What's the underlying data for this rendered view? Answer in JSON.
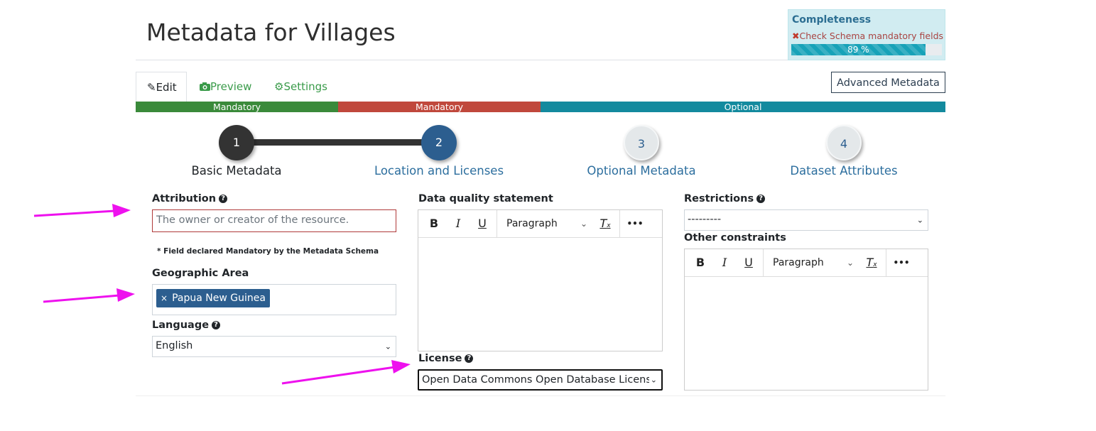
{
  "page": {
    "title": "Metadata for Villages"
  },
  "completeness": {
    "title": "Completeness",
    "check_icon": "x-icon",
    "check_text": "Check Schema mandatory fields",
    "progress_percent": 89,
    "progress_label": "89 %",
    "accent": "#17a2b8"
  },
  "tabs": [
    {
      "label": "Edit",
      "icon": "pencil-icon"
    },
    {
      "label": "Preview",
      "icon": "camera-icon"
    },
    {
      "label": "Settings",
      "icon": "gear-icon"
    }
  ],
  "advanced_button": "Advanced Metadata",
  "section_bar": [
    {
      "label": "Mandatory",
      "color": "#3a8a3a"
    },
    {
      "label": "Mandatory",
      "color": "#c0483c"
    },
    {
      "label": "Optional",
      "color": "#138a9e"
    }
  ],
  "steps": [
    {
      "number": "1",
      "label": "Basic Metadata",
      "state": "completed"
    },
    {
      "number": "2",
      "label": "Location and Licenses",
      "state": "active"
    },
    {
      "number": "3",
      "label": "Optional Metadata",
      "state": "inactive"
    },
    {
      "number": "4",
      "label": "Dataset Attributes",
      "state": "inactive"
    }
  ],
  "form": {
    "attribution": {
      "label": "Attribution",
      "placeholder": "The owner or creator of the resource.",
      "note": "* Field declared Mandatory by the Metadata Schema"
    },
    "geographic_area": {
      "label": "Geographic Area",
      "tag": "Papua New Guinea",
      "tag_remove": "×"
    },
    "language": {
      "label": "Language",
      "value": "English"
    },
    "data_quality": {
      "label": "Data quality statement"
    },
    "license": {
      "label": "License",
      "value": "Open Data Commons Open Database License"
    },
    "restrictions": {
      "label": "Restrictions",
      "value": "---------"
    },
    "other_constraints": {
      "label": "Other constraints"
    }
  },
  "editor_toolbar": {
    "bold": "B",
    "italic": "I",
    "underline": "U",
    "block_format": "Paragraph",
    "clear_format": "T",
    "clear_format_sub": "x",
    "more": "•••"
  },
  "annotation_color": "#ee11ee"
}
